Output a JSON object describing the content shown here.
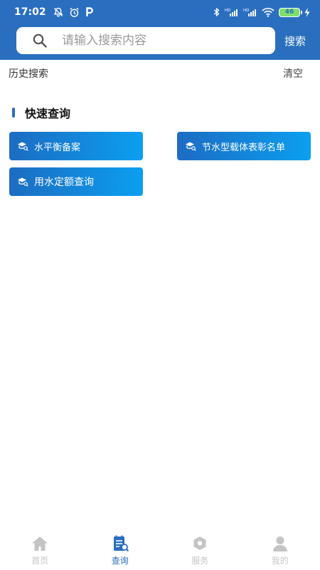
{
  "status_bar": {
    "time": "17:02",
    "network_labels": [
      "HD",
      "HD"
    ],
    "battery": "46",
    "icons": [
      "notification-off-icon",
      "alarm-icon",
      "parking-icon",
      "bluetooth-icon",
      "signal-icon",
      "signal-icon",
      "wifi-icon",
      "battery-icon",
      "charging-icon"
    ]
  },
  "search": {
    "placeholder": "请输入搜索内容",
    "button_label": "搜索"
  },
  "history": {
    "title": "历史搜索",
    "clear_label": "清空"
  },
  "quick_query": {
    "title": "快速查询",
    "items": [
      {
        "label": "水平衡备案",
        "icon": "graduation-cap-search-icon"
      },
      {
        "label": "节水型载体表彰名单",
        "icon": "graduation-cap-search-icon"
      },
      {
        "label": "用水定额查询",
        "icon": "graduation-cap-search-icon"
      }
    ]
  },
  "tabs": [
    {
      "label": "首页",
      "icon": "home-icon",
      "active": false
    },
    {
      "label": "查询",
      "icon": "query-icon",
      "active": true
    },
    {
      "label": "服务",
      "icon": "service-icon",
      "active": false
    },
    {
      "label": "我的",
      "icon": "user-icon",
      "active": false
    }
  ],
  "colors": {
    "primary": "#2a6fbf",
    "gradient_start": "#1c6cc2",
    "gradient_end": "#0b9ff0",
    "tab_inactive": "#c4c4c4"
  }
}
